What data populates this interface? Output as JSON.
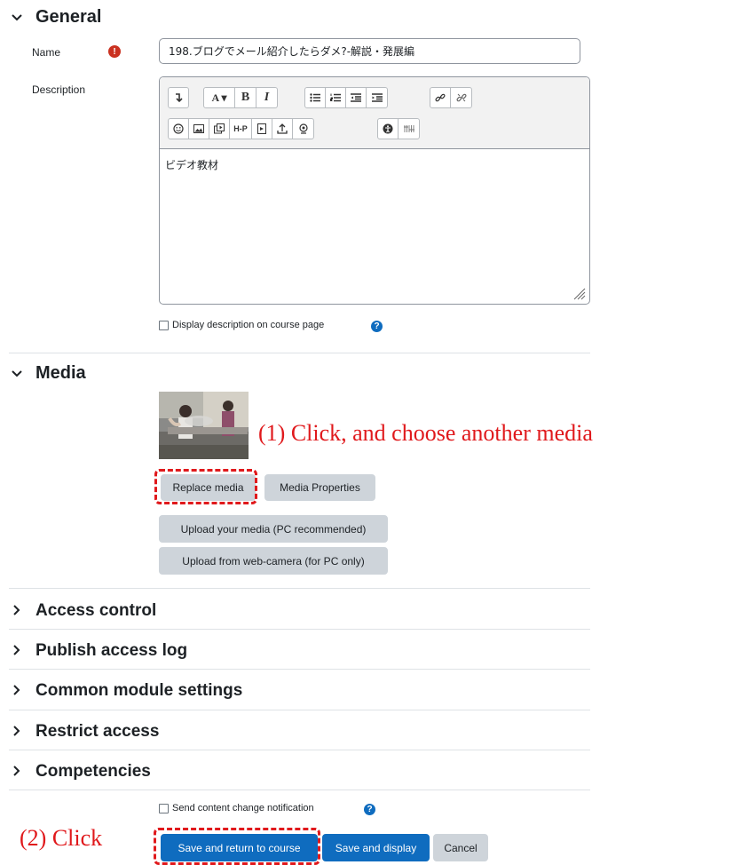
{
  "general": {
    "header": "General",
    "name_label": "Name",
    "name_value": "198.ブログでメール紹介したらダメ?-解説・発展編",
    "description_label": "Description",
    "description_text": "ビデオ教材",
    "display_description_label": "Display description on course page"
  },
  "editor": {
    "font_button": "A ▾",
    "bold": "B",
    "italic": "I",
    "h5p": "H-P"
  },
  "media": {
    "header": "Media",
    "replace_label": "Replace media",
    "properties_label": "Media Properties",
    "upload_label": "Upload your media (PC recommended)",
    "webcam_label": "Upload from web-camera (for PC only)"
  },
  "sections": [
    {
      "label": "Access control"
    },
    {
      "label": "Publish access log"
    },
    {
      "label": "Common module settings"
    },
    {
      "label": "Restrict access"
    },
    {
      "label": "Competencies"
    }
  ],
  "notification_label": "Send content change notification",
  "footer": {
    "save_return": "Save and return to course",
    "save_display": "Save and display",
    "cancel": "Cancel"
  },
  "annotations": {
    "step1": "(1) Click, and choose another media",
    "step2": "(2) Click"
  },
  "colors": {
    "primary": "#0f6cbf",
    "secondary_button": "#ced4da",
    "annotation_red": "#e0191c",
    "required_red": "#ca3120"
  },
  "icons": {
    "required": "exclamation-circle-icon",
    "help": "question-circle-icon",
    "expand": "chevron-down-icon",
    "collapsed": "chevron-right-icon"
  }
}
